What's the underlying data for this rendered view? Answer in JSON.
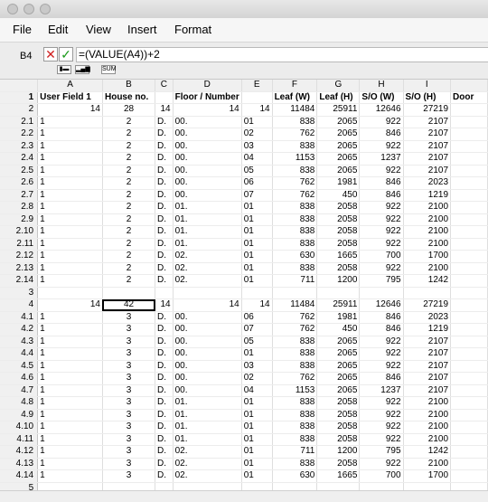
{
  "menu": [
    "File",
    "Edit",
    "View",
    "Insert",
    "Format"
  ],
  "formula_bar": {
    "cell_ref": "B4",
    "formula": "=(VALUE(A4))+2",
    "cancel_icon": "x-icon",
    "accept_icon": "check-icon"
  },
  "toolbar_icons": [
    "bar-chart-icon",
    "column-chart-icon",
    "sum-icon"
  ],
  "toolbar_sum_label": "SUM",
  "columns": [
    "",
    "A",
    "B",
    "C",
    "D",
    "E",
    "F",
    "G",
    "H",
    "I",
    ""
  ],
  "header_row": [
    "1",
    "User Field 1",
    "House no.",
    "",
    "Floor / Number",
    "",
    "Leaf (W)",
    "Leaf (H)",
    "S/O (W)",
    "S/O (H)",
    "Door"
  ],
  "rows": [
    {
      "id": "2",
      "type": "sum",
      "cells": [
        "14",
        "28",
        "14",
        "14",
        "14",
        "11484",
        "25911",
        "12646",
        "27219"
      ]
    },
    {
      "id": "2.1",
      "cells": [
        "1",
        "2",
        "D.",
        "00.",
        "01",
        "838",
        "2065",
        "922",
        "2107"
      ]
    },
    {
      "id": "2.2",
      "cells": [
        "1",
        "2",
        "D.",
        "00.",
        "02",
        "762",
        "2065",
        "846",
        "2107"
      ]
    },
    {
      "id": "2.3",
      "cells": [
        "1",
        "2",
        "D.",
        "00.",
        "03",
        "838",
        "2065",
        "922",
        "2107"
      ]
    },
    {
      "id": "2.4",
      "cells": [
        "1",
        "2",
        "D.",
        "00.",
        "04",
        "1153",
        "2065",
        "1237",
        "2107"
      ]
    },
    {
      "id": "2.5",
      "cells": [
        "1",
        "2",
        "D.",
        "00.",
        "05",
        "838",
        "2065",
        "922",
        "2107"
      ]
    },
    {
      "id": "2.6",
      "cells": [
        "1",
        "2",
        "D.",
        "00.",
        "06",
        "762",
        "1981",
        "846",
        "2023"
      ]
    },
    {
      "id": "2.7",
      "cells": [
        "1",
        "2",
        "D.",
        "00.",
        "07",
        "762",
        "450",
        "846",
        "1219"
      ]
    },
    {
      "id": "2.8",
      "cells": [
        "1",
        "2",
        "D.",
        "01.",
        "01",
        "838",
        "2058",
        "922",
        "2100"
      ]
    },
    {
      "id": "2.9",
      "cells": [
        "1",
        "2",
        "D.",
        "01.",
        "01",
        "838",
        "2058",
        "922",
        "2100"
      ]
    },
    {
      "id": "2.10",
      "cells": [
        "1",
        "2",
        "D.",
        "01.",
        "01",
        "838",
        "2058",
        "922",
        "2100"
      ]
    },
    {
      "id": "2.11",
      "cells": [
        "1",
        "2",
        "D.",
        "01.",
        "01",
        "838",
        "2058",
        "922",
        "2100"
      ]
    },
    {
      "id": "2.12",
      "cells": [
        "1",
        "2",
        "D.",
        "02.",
        "01",
        "630",
        "1665",
        "700",
        "1700"
      ]
    },
    {
      "id": "2.13",
      "cells": [
        "1",
        "2",
        "D.",
        "02.",
        "01",
        "838",
        "2058",
        "922",
        "2100"
      ]
    },
    {
      "id": "2.14",
      "cells": [
        "1",
        "2",
        "D.",
        "02.",
        "01",
        "711",
        "1200",
        "795",
        "1242"
      ]
    },
    {
      "id": "3",
      "type": "blank",
      "cells": [
        "",
        "",
        "",
        "",
        "",
        "",
        "",
        "",
        ""
      ]
    },
    {
      "id": "4",
      "type": "sum",
      "cells": [
        "14",
        "42",
        "14",
        "14",
        "14",
        "11484",
        "25911",
        "12646",
        "27219"
      ]
    },
    {
      "id": "4.1",
      "cells": [
        "1",
        "3",
        "D.",
        "00.",
        "06",
        "762",
        "1981",
        "846",
        "2023"
      ]
    },
    {
      "id": "4.2",
      "cells": [
        "1",
        "3",
        "D.",
        "00.",
        "07",
        "762",
        "450",
        "846",
        "1219"
      ]
    },
    {
      "id": "4.3",
      "cells": [
        "1",
        "3",
        "D.",
        "00.",
        "05",
        "838",
        "2065",
        "922",
        "2107"
      ]
    },
    {
      "id": "4.4",
      "cells": [
        "1",
        "3",
        "D.",
        "00.",
        "01",
        "838",
        "2065",
        "922",
        "2107"
      ]
    },
    {
      "id": "4.5",
      "cells": [
        "1",
        "3",
        "D.",
        "00.",
        "03",
        "838",
        "2065",
        "922",
        "2107"
      ]
    },
    {
      "id": "4.6",
      "cells": [
        "1",
        "3",
        "D.",
        "00.",
        "02",
        "762",
        "2065",
        "846",
        "2107"
      ]
    },
    {
      "id": "4.7",
      "cells": [
        "1",
        "3",
        "D.",
        "00.",
        "04",
        "1153",
        "2065",
        "1237",
        "2107"
      ]
    },
    {
      "id": "4.8",
      "cells": [
        "1",
        "3",
        "D.",
        "01.",
        "01",
        "838",
        "2058",
        "922",
        "2100"
      ]
    },
    {
      "id": "4.9",
      "cells": [
        "1",
        "3",
        "D.",
        "01.",
        "01",
        "838",
        "2058",
        "922",
        "2100"
      ]
    },
    {
      "id": "4.10",
      "cells": [
        "1",
        "3",
        "D.",
        "01.",
        "01",
        "838",
        "2058",
        "922",
        "2100"
      ]
    },
    {
      "id": "4.11",
      "cells": [
        "1",
        "3",
        "D.",
        "01.",
        "01",
        "838",
        "2058",
        "922",
        "2100"
      ]
    },
    {
      "id": "4.12",
      "cells": [
        "1",
        "3",
        "D.",
        "02.",
        "01",
        "711",
        "1200",
        "795",
        "1242"
      ]
    },
    {
      "id": "4.13",
      "cells": [
        "1",
        "3",
        "D.",
        "02.",
        "01",
        "838",
        "2058",
        "922",
        "2100"
      ]
    },
    {
      "id": "4.14",
      "cells": [
        "1",
        "3",
        "D.",
        "02.",
        "01",
        "630",
        "1665",
        "700",
        "1700"
      ]
    },
    {
      "id": "5",
      "type": "blank",
      "cells": [
        "",
        "",
        "",
        "",
        "",
        "",
        "",
        "",
        ""
      ]
    }
  ],
  "active_cell": "B4"
}
